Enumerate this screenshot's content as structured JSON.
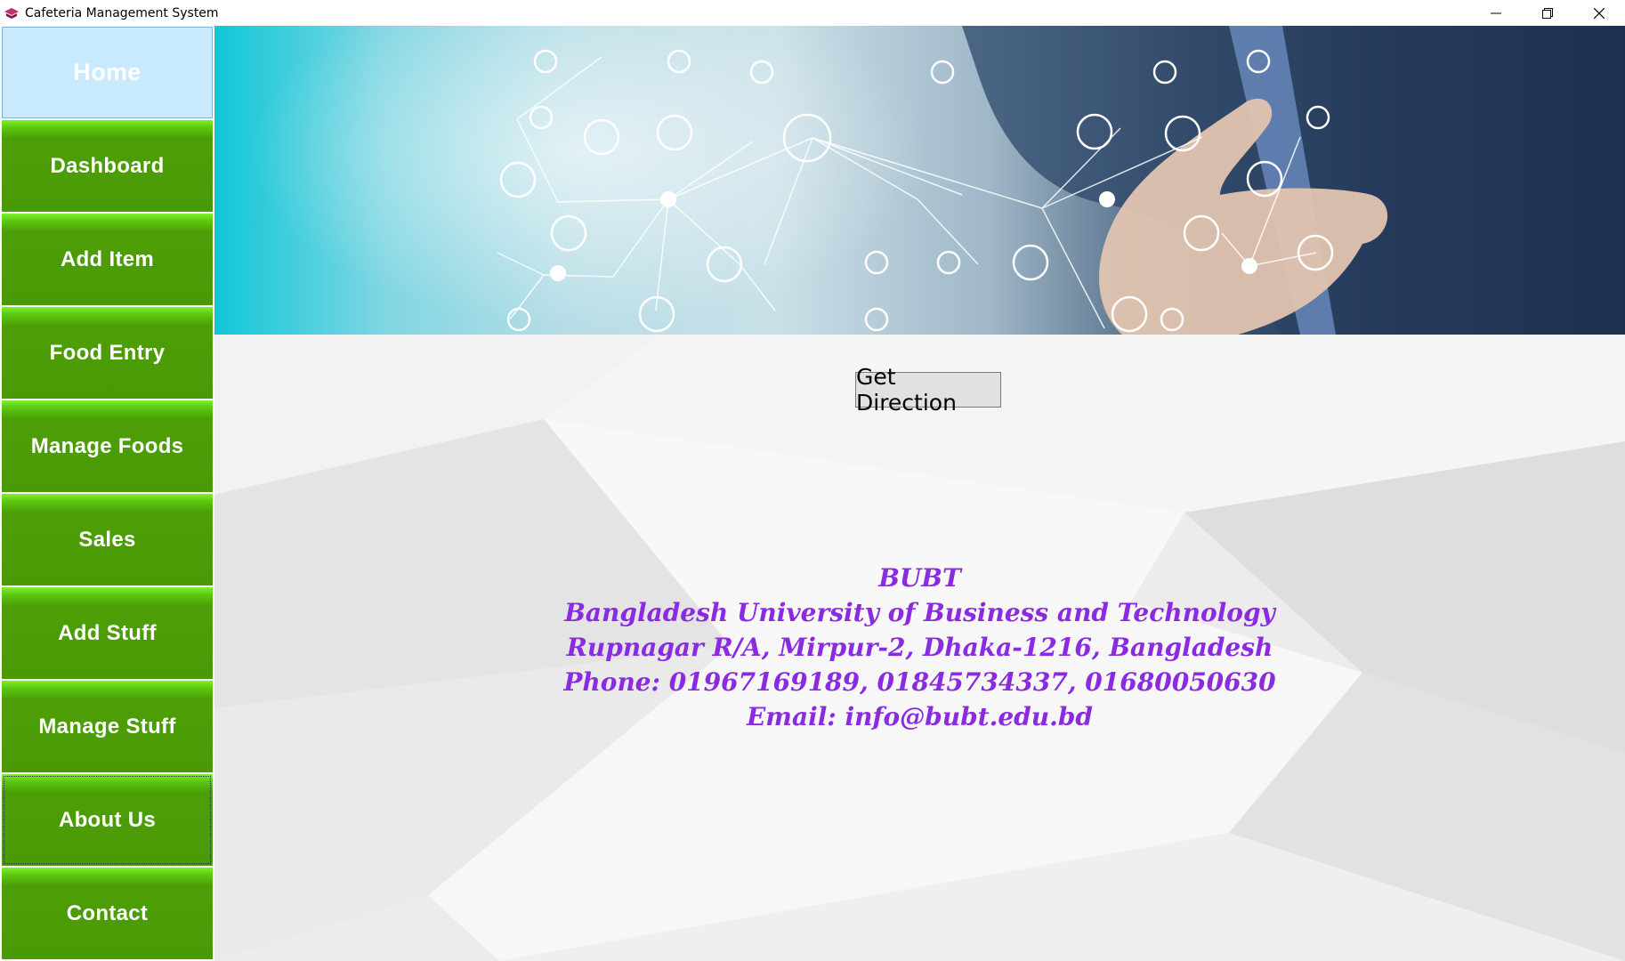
{
  "window": {
    "title": "Cafeteria Management System",
    "controls": [
      "minimize",
      "restore",
      "close"
    ]
  },
  "sidebar": {
    "items": [
      {
        "label": "Home",
        "state": "active"
      },
      {
        "label": "Dashboard"
      },
      {
        "label": "Add Item"
      },
      {
        "label": "Food Entry"
      },
      {
        "label": "Manage Foods"
      },
      {
        "label": "Sales"
      },
      {
        "label": "Add Stuff"
      },
      {
        "label": "Manage Stuff"
      },
      {
        "label": "About Us",
        "state": "focused"
      },
      {
        "label": "Contact"
      }
    ],
    "colors": {
      "button": "#4a9a05",
      "active": "#c9e9ff",
      "text": "#ffffff"
    }
  },
  "main": {
    "direction_button": "Get Direction",
    "address": {
      "line1": "BUBT",
      "line2": "Bangladesh University of Business and Technology",
      "line3": "Rupnagar R/A, Mirpur-2, Dhaka-1216, Bangladesh",
      "line4": "Phone: 01967169189, 01845734337, 01680050630",
      "line5": "Email: info@bubt.edu.bd",
      "color": "#8a2be2"
    }
  }
}
